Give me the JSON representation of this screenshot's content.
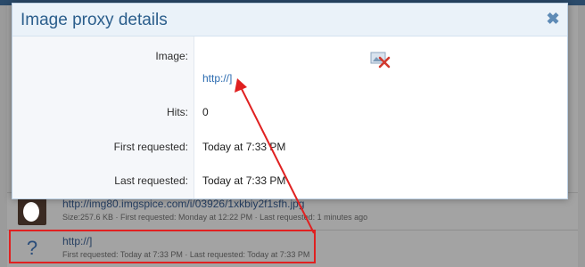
{
  "background": {
    "rows": [
      {
        "title": "http://img80.imgspice.com/i/03926/1xkbiy2f1sfh.jpg",
        "meta": "Size:257.6 KB · First requested: Monday at 12:22 PM · Last requested: 1 minutes ago"
      },
      {
        "icon_glyph": "?",
        "title": "http://]",
        "meta": "First requested: Today at 7:33 PM · Last requested: Today at 7:33 PM"
      }
    ]
  },
  "modal": {
    "title": "Image proxy details",
    "close_glyph": "✖",
    "fields": {
      "image_label": "Image:",
      "image_link": "http://]",
      "hits_label": "Hits:",
      "hits_value": "0",
      "first_label": "First requested:",
      "first_value": "Today at 7:33 PM",
      "last_label": "Last requested:",
      "last_value": "Today at 7:33 PM"
    }
  },
  "colors": {
    "accent": "#2b5e8c",
    "annotation": "#e02020"
  }
}
